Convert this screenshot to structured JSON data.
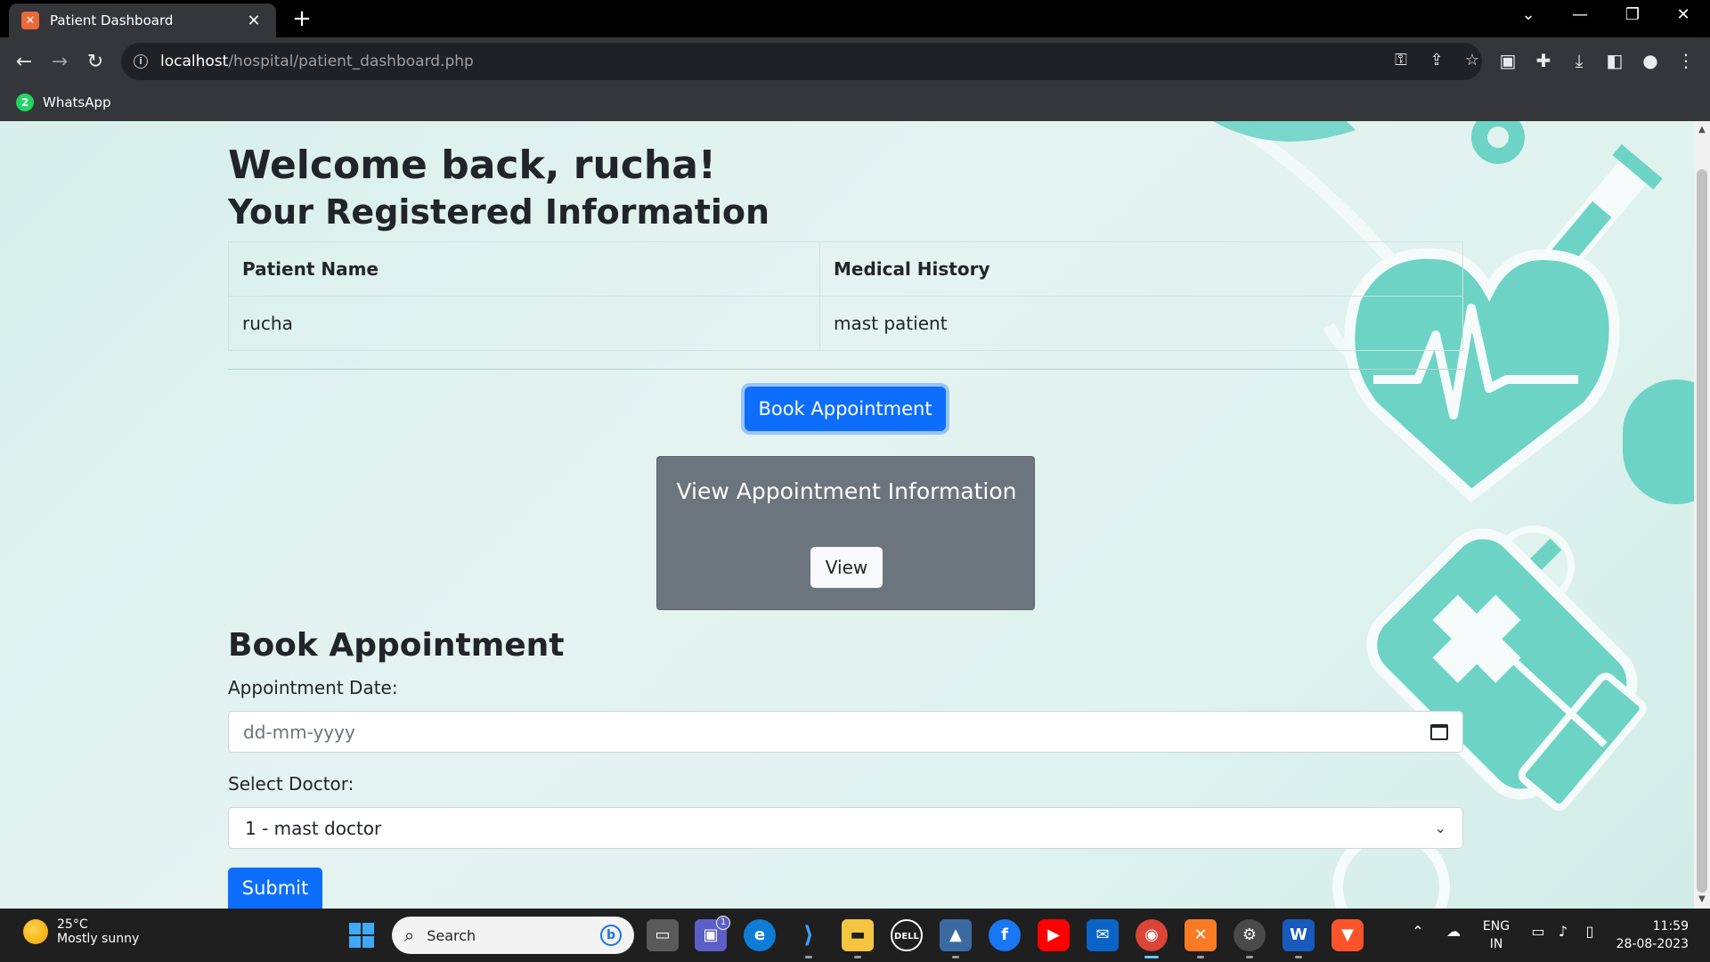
{
  "browser": {
    "tab_title": "Patient Dashboard",
    "tab_close": "✕",
    "new_tab": "+",
    "url_host": "localhost",
    "url_path": "/hospital/patient_dashboard.php",
    "bookmark_label": "WhatsApp",
    "whatsapp_badge": "2"
  },
  "page": {
    "welcome": "Welcome back, rucha!",
    "registered_title": "Your Registered Information",
    "table": {
      "headers": [
        "Patient Name",
        "Medical History"
      ],
      "row": [
        "rucha",
        "mast patient"
      ]
    },
    "book_button": "Book Appointment",
    "view_card": {
      "title": "View Appointment Information",
      "button": "View"
    },
    "form": {
      "title": "Book Appointment",
      "date_label": "Appointment Date:",
      "date_placeholder": "dd-mm-yyyy",
      "doctor_label": "Select Doctor:",
      "doctor_selected": "1 - mast doctor",
      "submit": "Submit"
    }
  },
  "taskbar": {
    "weather_temp": "25°C",
    "weather_desc": "Mostly sunny",
    "search_placeholder": "Search",
    "language": "ENG",
    "region": "IN",
    "time": "11:59",
    "date": "28-08-2023",
    "teams_badge": "1"
  },
  "colors": {
    "primary": "#0d6efd",
    "card_gray": "#6c757d",
    "page_bg": "#dff2ee",
    "decor_teal": "#6dd3c5"
  }
}
